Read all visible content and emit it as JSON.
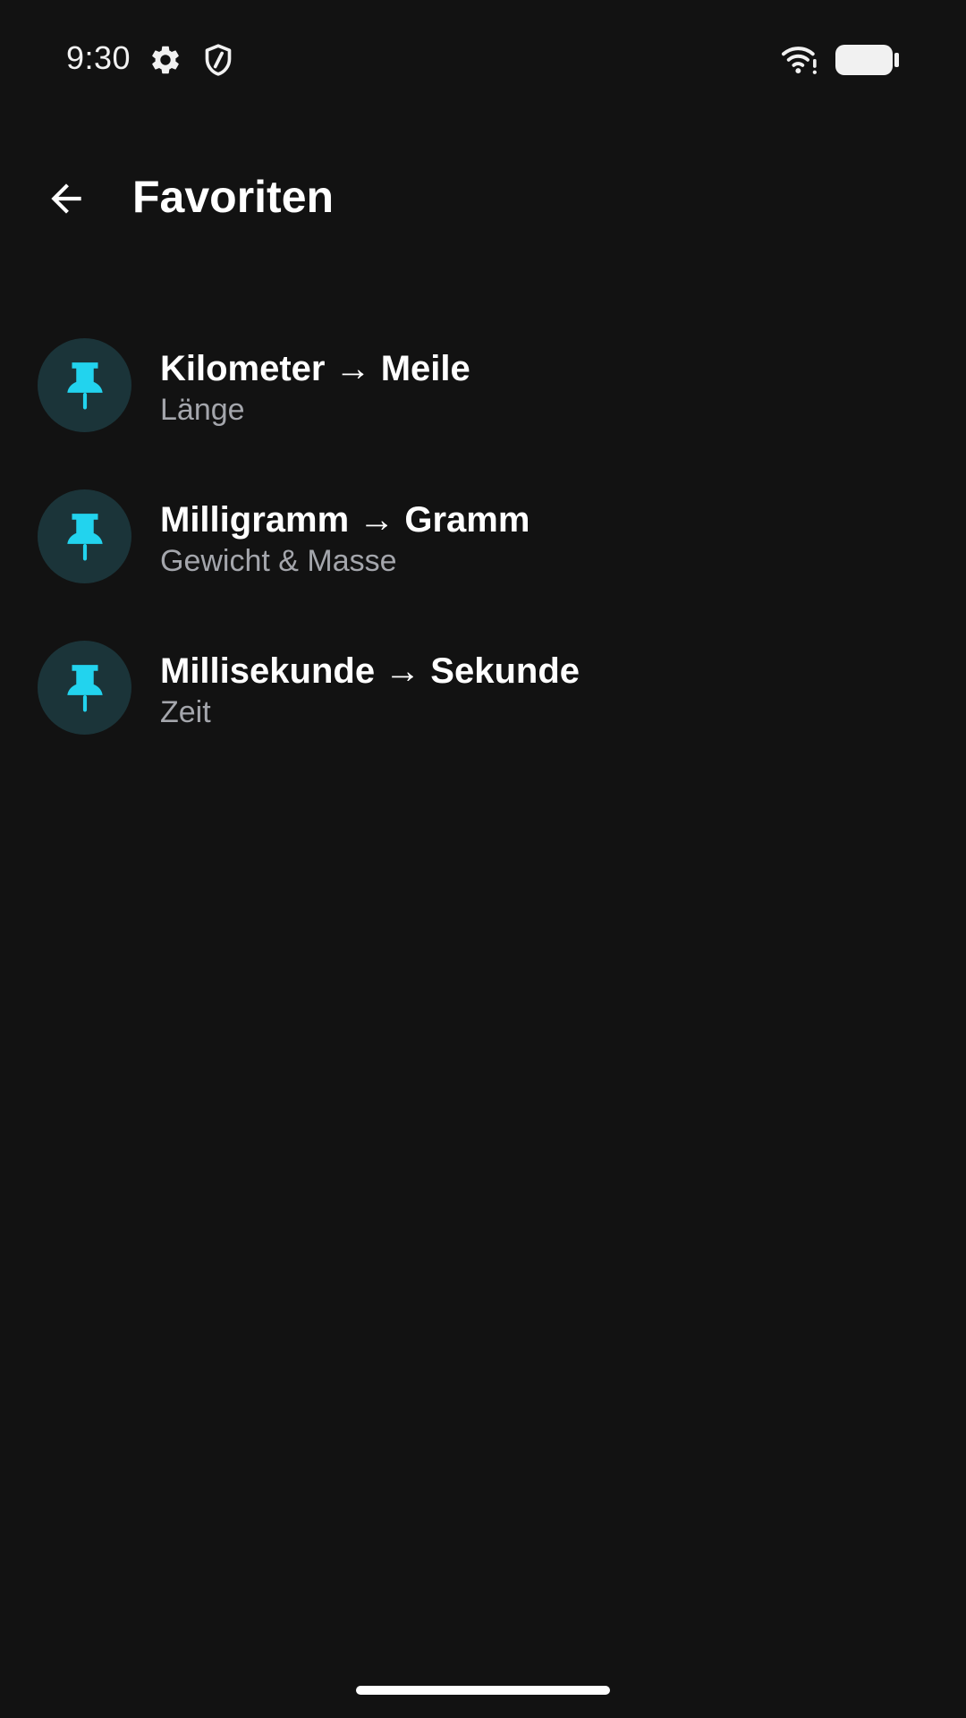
{
  "status_bar": {
    "time": "9:30",
    "icons": [
      "gear-icon",
      "shield-icon",
      "wifi-alert-icon",
      "battery-icon"
    ]
  },
  "app_bar": {
    "back_icon": "arrow-left-icon",
    "title": "Favoriten"
  },
  "favorites": [
    {
      "title": "Kilometer → Meile",
      "subtitle": "Länge",
      "icon": "pin-icon"
    },
    {
      "title": "Milligramm → Gramm",
      "subtitle": "Gewicht & Masse",
      "icon": "pin-icon"
    },
    {
      "title": "Millisekunde → Sekunde",
      "subtitle": "Zeit",
      "icon": "pin-icon"
    }
  ],
  "colors": {
    "background": "#121212",
    "accent": "#22d3ee",
    "avatar_background": "#1b3439",
    "subtitle_text": "#a4a6ac"
  }
}
